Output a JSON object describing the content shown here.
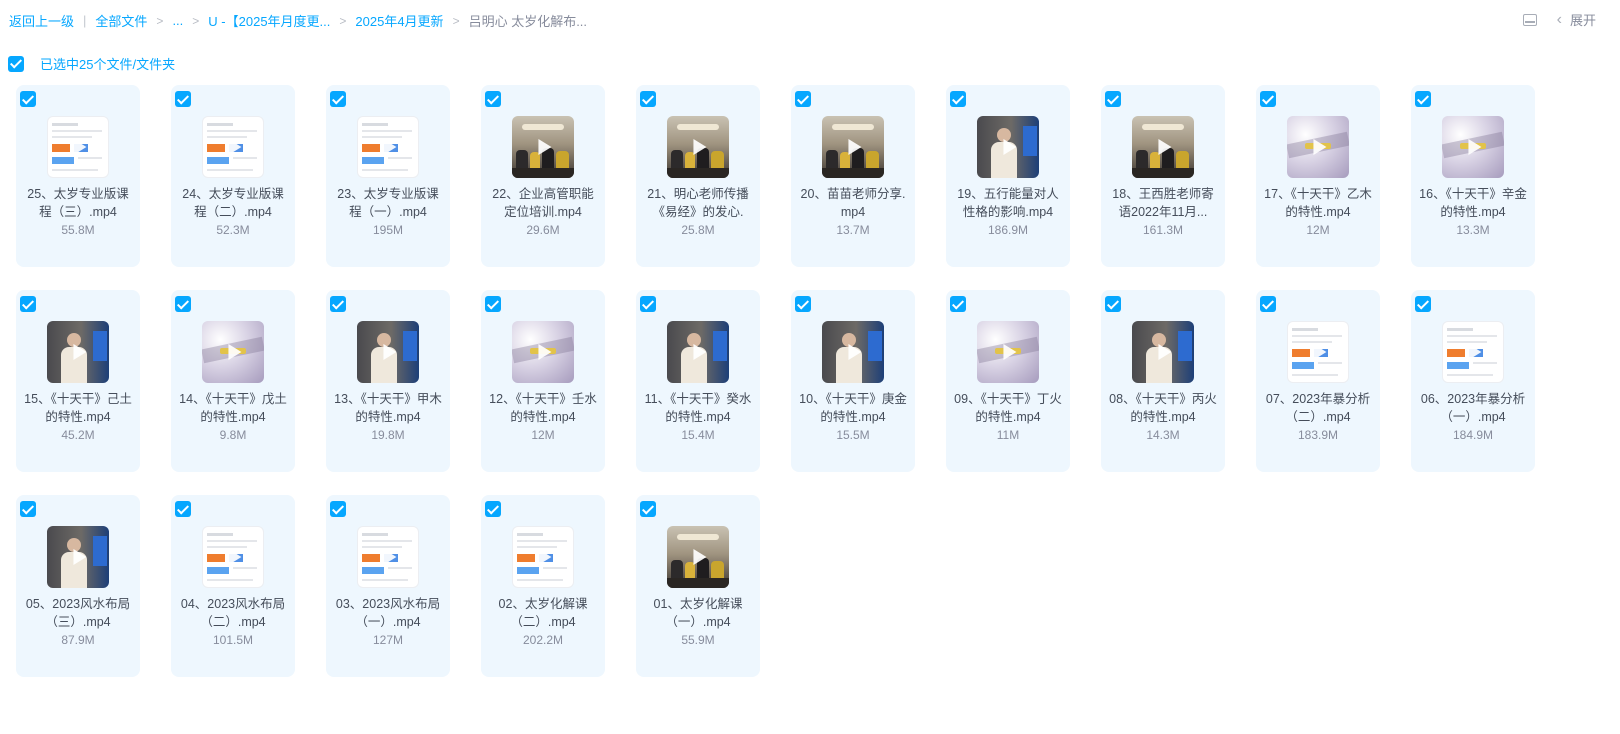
{
  "breadcrumb": {
    "back": "返回上一级",
    "root": "全部文件",
    "ellipsis": "...",
    "folder1": "U -【2025年月度更...",
    "folder2": "2025年4月更新",
    "current": "吕明心 太岁化解布..."
  },
  "toolbar": {
    "expand_label": "展开"
  },
  "selection": {
    "label": "已选中25个文件/文件夹"
  },
  "colors": {
    "accent": "#06a7ff",
    "card_bg": "#eef7fe"
  },
  "files": [
    {
      "name": "25、太岁专业版课程（三）.mp4",
      "size": "55.8M",
      "thumb": "doc"
    },
    {
      "name": "24、太岁专业版课程（二）.mp4",
      "size": "52.3M",
      "thumb": "doc"
    },
    {
      "name": "23、太岁专业版课程（一）.mp4",
      "size": "195M",
      "thumb": "doc"
    },
    {
      "name": "22、企业高管职能定位培训.mp4",
      "size": "29.6M",
      "thumb": "room"
    },
    {
      "name": "21、明心老师传播《易经》的发心.",
      "size": "25.8M",
      "thumb": "room"
    },
    {
      "name": "20、苗苗老师分享.mp4",
      "size": "13.7M",
      "thumb": "room"
    },
    {
      "name": "19、五行能量对人性格的影响.mp4",
      "size": "186.9M",
      "thumb": "speaker"
    },
    {
      "name": "18、王西胜老师寄语2022年11月...",
      "size": "161.3M",
      "thumb": "room"
    },
    {
      "name": "17、《十天干》乙木的特性.mp4",
      "size": "12M",
      "thumb": "cloud"
    },
    {
      "name": "16、《十天干》辛金的特性.mp4",
      "size": "13.3M",
      "thumb": "cloud"
    },
    {
      "name": "15、《十天干》己土的特性.mp4",
      "size": "45.2M",
      "thumb": "speaker"
    },
    {
      "name": "14、《十天干》戊土的特性.mp4",
      "size": "9.8M",
      "thumb": "cloud"
    },
    {
      "name": "13、《十天干》甲木的特性.mp4",
      "size": "19.8M",
      "thumb": "speaker"
    },
    {
      "name": "12、《十天干》壬水的特性.mp4",
      "size": "12M",
      "thumb": "cloud"
    },
    {
      "name": "11、《十天干》癸水的特性.mp4",
      "size": "15.4M",
      "thumb": "speaker"
    },
    {
      "name": "10、《十天干》庚金的特性.mp4",
      "size": "15.5M",
      "thumb": "speaker"
    },
    {
      "name": "09、《十天干》丁火的特性.mp4",
      "size": "11M",
      "thumb": "cloud"
    },
    {
      "name": "08、《十天干》丙火的特性.mp4",
      "size": "14.3M",
      "thumb": "speaker"
    },
    {
      "name": "07、2023年暴分析（二）.mp4",
      "size": "183.9M",
      "thumb": "doc"
    },
    {
      "name": "06、2023年暴分析（一）.mp4",
      "size": "184.9M",
      "thumb": "doc"
    },
    {
      "name": "05、2023风水布局（三）.mp4",
      "size": "87.9M",
      "thumb": "speaker"
    },
    {
      "name": "04、2023风水布局（二）.mp4",
      "size": "101.5M",
      "thumb": "doc"
    },
    {
      "name": "03、2023风水布局（一）.mp4",
      "size": "127M",
      "thumb": "doc"
    },
    {
      "name": "02、太岁化解课（二）.mp4",
      "size": "202.2M",
      "thumb": "doc"
    },
    {
      "name": "01、太岁化解课（一）.mp4",
      "size": "55.9M",
      "thumb": "room"
    }
  ]
}
